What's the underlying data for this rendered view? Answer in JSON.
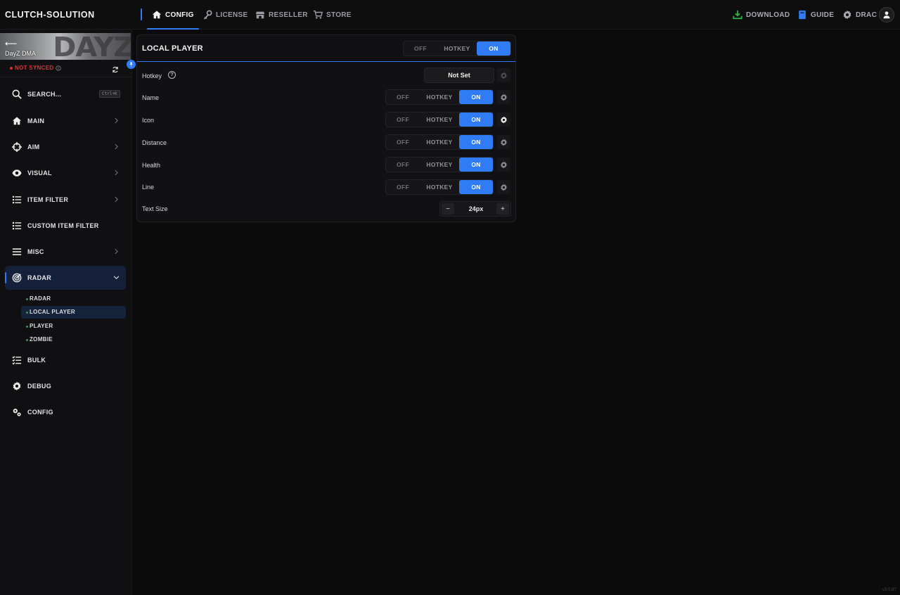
{
  "app": {
    "brand": "CLUTCH-SOLUTION",
    "version": "v3.0.87"
  },
  "colors": {
    "accent": "#2f7cf6",
    "danger": "#e03131",
    "success": "#2f9e54",
    "download": "#2fb344"
  },
  "topnav": {
    "tabs": [
      {
        "label": "CONFIG",
        "icon": "home-icon",
        "active": true
      },
      {
        "label": "LICENSE",
        "icon": "key-icon",
        "active": false
      },
      {
        "label": "RESELLER",
        "icon": "store-icon",
        "active": false
      },
      {
        "label": "STORE",
        "icon": "cart-icon",
        "active": false
      }
    ],
    "right": [
      {
        "label": "DOWNLOAD",
        "icon": "download-icon"
      },
      {
        "label": "GUIDE",
        "icon": "book-icon"
      },
      {
        "label": "DRAC",
        "icon": "gear-icon"
      }
    ]
  },
  "sidebar": {
    "game": "DayZ DMA",
    "sync_status": "NOT SYNCED",
    "search": {
      "label": "SEARCH...",
      "shortcut": "Ctrl+K"
    },
    "items": [
      {
        "label": "MAIN",
        "icon": "home-icon"
      },
      {
        "label": "AIM",
        "icon": "crosshair-icon"
      },
      {
        "label": "VISUAL",
        "icon": "eye-icon"
      },
      {
        "label": "ITEM FILTER",
        "icon": "list-icon"
      },
      {
        "label": "CUSTOM ITEM FILTER",
        "icon": "list-icon"
      },
      {
        "label": "MISC",
        "icon": "menu-icon"
      },
      {
        "label": "RADAR",
        "icon": "radar-icon",
        "expanded": true
      },
      {
        "label": "BULK",
        "icon": "checklist-icon"
      },
      {
        "label": "DEBUG",
        "icon": "gear-icon"
      },
      {
        "label": "CONFIG",
        "icon": "gears-icon"
      }
    ],
    "radar_sub": [
      {
        "label": "RADAR",
        "active": false
      },
      {
        "label": "LOCAL PLAYER",
        "active": true
      },
      {
        "label": "PLAYER",
        "active": false
      },
      {
        "label": "ZOMBIE",
        "active": false
      }
    ]
  },
  "panel": {
    "title": "LOCAL PLAYER",
    "toggle": {
      "off": "OFF",
      "hotkey": "HOTKEY",
      "on": "ON",
      "selected": "ON"
    },
    "hotkey": {
      "label": "Hotkey",
      "value": "Not Set"
    },
    "rows": [
      {
        "label": "Name",
        "off": "OFF",
        "hotkey": "HOTKEY",
        "on": "ON",
        "selected": "ON"
      },
      {
        "label": "Icon",
        "off": "OFF",
        "hotkey": "HOTKEY",
        "on": "ON",
        "selected": "ON"
      },
      {
        "label": "Distance",
        "off": "OFF",
        "hotkey": "HOTKEY",
        "on": "ON",
        "selected": "ON"
      },
      {
        "label": "Health",
        "off": "OFF",
        "hotkey": "HOTKEY",
        "on": "ON",
        "selected": "ON"
      },
      {
        "label": "Line",
        "off": "OFF",
        "hotkey": "HOTKEY",
        "on": "ON",
        "selected": "ON"
      }
    ],
    "text_size": {
      "label": "Text Size",
      "value": "24px",
      "minus": "−",
      "plus": "+"
    }
  }
}
